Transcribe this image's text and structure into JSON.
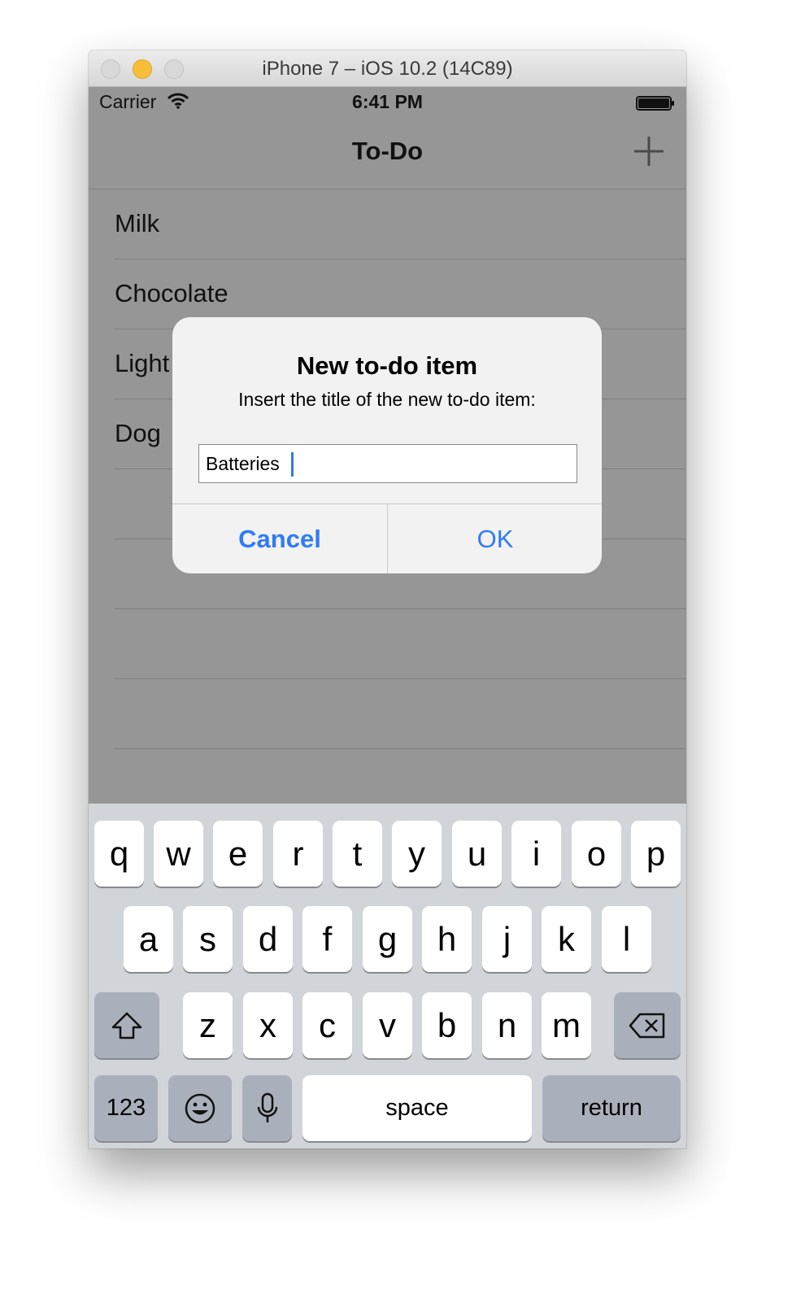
{
  "window": {
    "title": "iPhone 7 – iOS 10.2 (14C89)"
  },
  "status_bar": {
    "carrier": "Carrier",
    "time": "6:41 PM"
  },
  "nav": {
    "title": "To-Do",
    "add_icon": "plus-icon"
  },
  "list": {
    "items": [
      "Milk",
      "Chocolate",
      "Light",
      "Dog"
    ]
  },
  "alert": {
    "title": "New to-do item",
    "message": "Insert the title of the new to-do item:",
    "field_value": "Batteries",
    "cancel_label": "Cancel",
    "ok_label": "OK"
  },
  "keyboard": {
    "row1": [
      "q",
      "w",
      "e",
      "r",
      "t",
      "y",
      "u",
      "i",
      "o",
      "p"
    ],
    "row2": [
      "a",
      "s",
      "d",
      "f",
      "g",
      "h",
      "j",
      "k",
      "l"
    ],
    "row3": [
      "z",
      "x",
      "c",
      "v",
      "b",
      "n",
      "m"
    ],
    "numbers_label": "123",
    "space_label": "space",
    "return_label": "return"
  },
  "colors": {
    "accent": "#2f7bf5",
    "dim_background": "#969696",
    "keyboard_bg": "#d1d4d9"
  }
}
